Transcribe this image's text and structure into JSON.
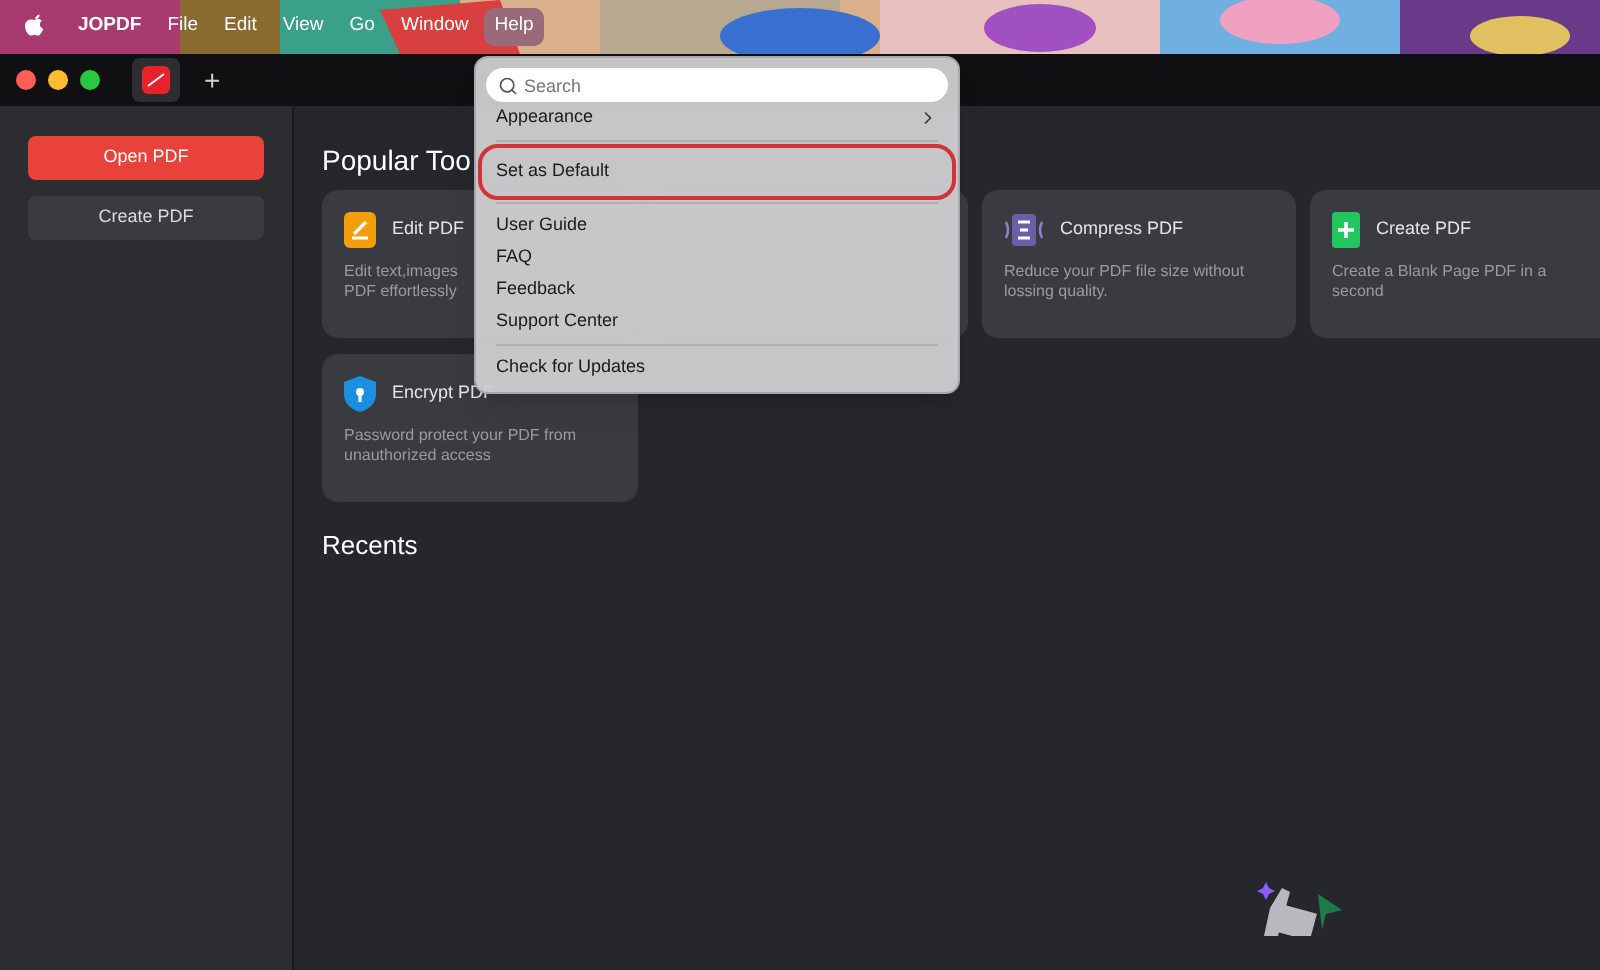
{
  "menubar": {
    "items": [
      {
        "label": "JOPDF",
        "kind": "app",
        "selected": false
      },
      {
        "label": "File",
        "kind": "menu",
        "selected": false
      },
      {
        "label": "Edit",
        "kind": "menu",
        "selected": false
      },
      {
        "label": "View",
        "kind": "menu",
        "selected": false
      },
      {
        "label": "Go",
        "kind": "menu",
        "selected": false
      },
      {
        "label": "Window",
        "kind": "menu",
        "selected": false
      },
      {
        "label": "Help",
        "kind": "menu",
        "selected": true
      }
    ]
  },
  "tabbar": {
    "new_tab": "+"
  },
  "sidebar": {
    "buttons": [
      {
        "label": "Open PDF",
        "kind": "primary"
      },
      {
        "label": "Create PDF",
        "kind": "secondary"
      }
    ]
  },
  "popular_tools": {
    "title": "Popular Too",
    "cards": [
      {
        "kind": "tool",
        "title": "Edit PDF",
        "description": [
          "Edit text,images",
          "PDF effortlessly"
        ]
      },
      {
        "kind": "hidden"
      },
      {
        "kind": "tool",
        "title": "Compress PDF",
        "description": [
          "Reduce your PDF file size without",
          "lossing quality."
        ]
      },
      {
        "kind": "tool",
        "title": "Create PDF",
        "description": [
          "Create a Blank Page PDF in a",
          "second"
        ]
      },
      {
        "kind": "tool",
        "title": "Encrypt PDF",
        "description": [
          "Password protect your PDF from",
          "unauthorized access"
        ]
      }
    ]
  },
  "recents": {
    "title": "Recents"
  },
  "help_menu": {
    "search": {
      "placeholder": "Search"
    },
    "items": [
      {
        "label": "Appearance",
        "kind": "submenu",
        "highlighted": false
      },
      {
        "kind": "separator"
      },
      {
        "label": "Set as Default",
        "kind": "item",
        "highlighted": true
      },
      {
        "kind": "separator"
      },
      {
        "label": "User Guide",
        "kind": "item",
        "highlighted": false
      },
      {
        "label": "FAQ",
        "kind": "item",
        "highlighted": false
      },
      {
        "label": "Feedback",
        "kind": "item",
        "highlighted": false
      },
      {
        "label": "Support Center",
        "kind": "item",
        "highlighted": false
      },
      {
        "kind": "separator"
      },
      {
        "label": "Check for Updates",
        "kind": "item",
        "highlighted": false
      }
    ]
  }
}
